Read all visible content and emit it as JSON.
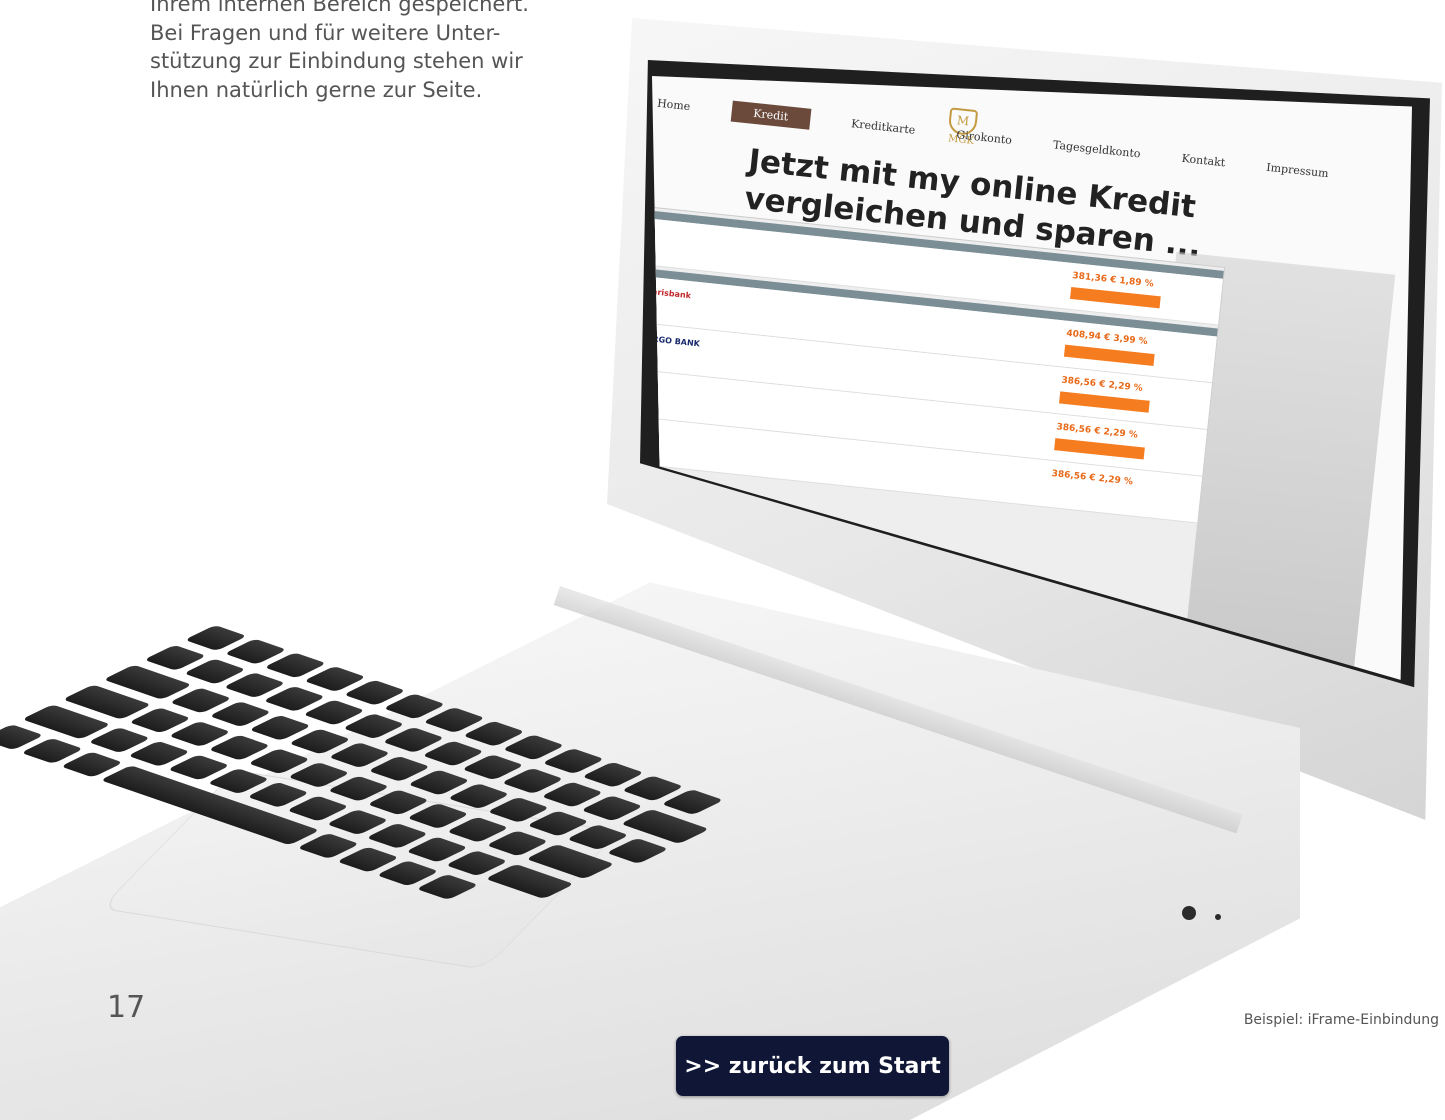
{
  "intro": {
    "lines": [
      "Ihrem internen Bereich gespeichert.",
      "Bei Fragen und für weitere Unter-",
      "stützung zur Einbindung stehen wir",
      "Ihnen natürlich gerne zur Seite."
    ]
  },
  "page_number": "17",
  "caption": "Beispiel: iFrame-Einbindung",
  "back_button": ">> zurück zum Start",
  "screen": {
    "nav": [
      "Home",
      "Kredit",
      "Kreditkarte",
      "Girokonto",
      "Tagesgeldkonto",
      "Kontakt",
      "Impressum"
    ],
    "logo": "MGK",
    "headline": "Jetzt mit my online Kredit vergleichen und sparen ...",
    "offers": [
      {
        "bank": "narisbank",
        "rate": "408,94 €  3,99 %"
      },
      {
        "bank": "TARGO BANK",
        "rate": "386,56 €  2,29 %"
      },
      {
        "bank": "",
        "rate": "386,56 €  2,29 %"
      },
      {
        "bank": "",
        "rate": "386,56 €  2,29 %"
      }
    ],
    "top_rate": "381,36 €  1,89 %"
  },
  "colors": {
    "button_bg": "#101636",
    "nav_active": "#6b4a3c",
    "accent_orange": "#f57c1f"
  }
}
